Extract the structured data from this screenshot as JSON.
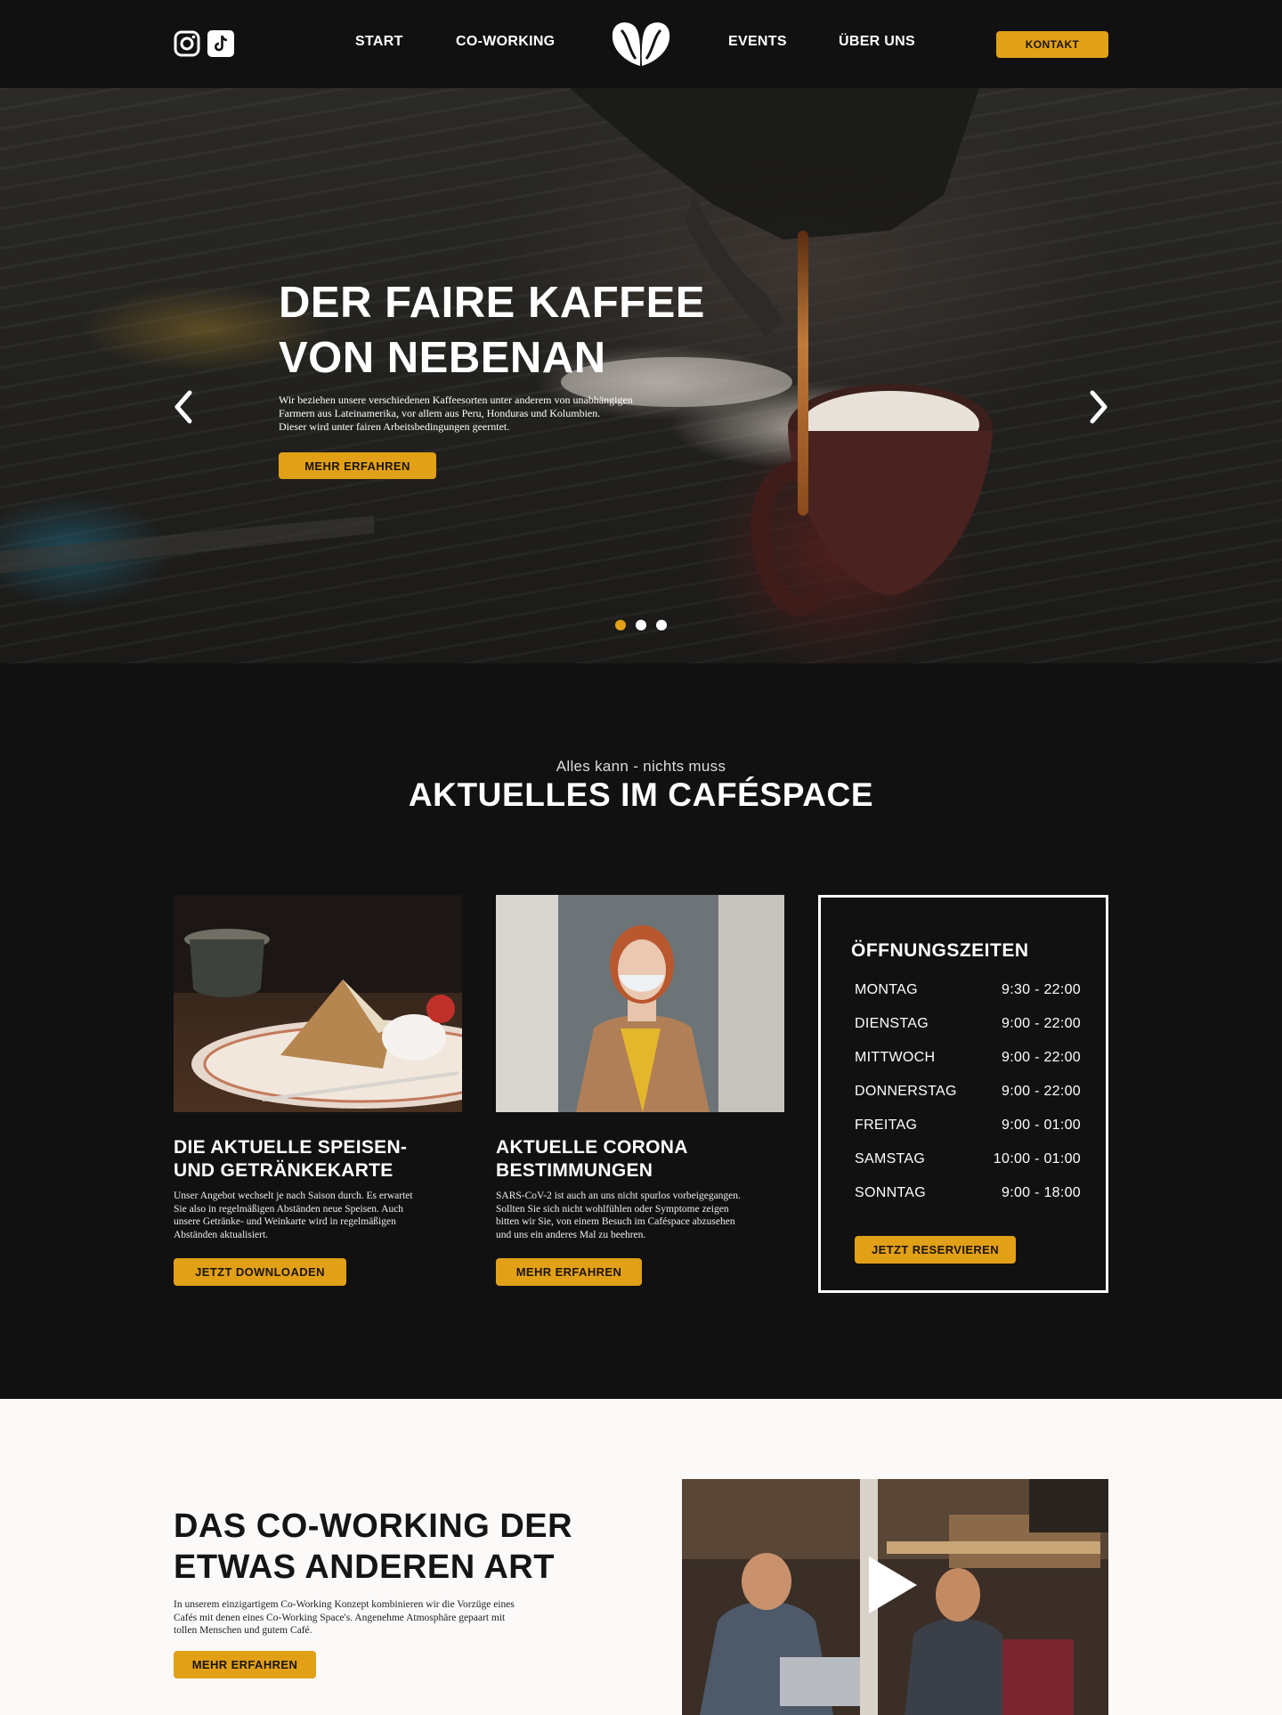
{
  "nav": {
    "links": [
      "START",
      "CO-WORKING",
      "EVENTS",
      "ÜBER UNS"
    ],
    "contact_label": "KONTAKT",
    "social_icons": [
      "instagram-icon",
      "tiktok-icon"
    ],
    "logo_icon": "coffee-bean-heart-logo"
  },
  "hero": {
    "title_line1": "DER FAIRE KAFFEE",
    "title_line2": "VON NEBENAN",
    "text_line1": "Wir beziehen unsere verschiedenen Kaffeesorten unter anderem von unabhängigen",
    "text_line2": "Farmern aus Lateinamerika, vor allem aus Peru, Honduras und Kolumbien.",
    "text_line3": "Dieser wird unter fairen Arbeitsbedingungen geerntet.",
    "button": "MEHR ERFAHREN",
    "slide_count": 3,
    "active_slide": 1
  },
  "aktuelles": {
    "subtitle": "Alles kann - nichts muss",
    "title": "AKTUELLES IM CAFÉSPACE",
    "cards": [
      {
        "title_line1": "DIE AKTUELLE SPEISEN-",
        "title_line2": "UND GETRÄNKEKARTE",
        "text_lines": [
          "Unser Angebot wechselt je nach Saison durch. Es erwartet",
          "Sie also in regelmäßigen Abständen neue Speisen. Auch",
          "unsere Getränke- und Weinkarte wird in regelmäßigen",
          "Abständen aktualisiert."
        ],
        "button": "JETZT DOWNLOADEN"
      },
      {
        "title_line1": "AKTUELLE CORONA",
        "title_line2": "BESTIMMUNGEN",
        "text_lines": [
          "SARS-CoV-2 ist auch an uns nicht spurlos vorbeigegangen.",
          "Sollten Sie sich nicht wohlfühlen oder Symptome zeigen",
          "bitten wir Sie, von einem Besuch im Caféspace abzusehen",
          "und uns ein anderes Mal zu beehren."
        ],
        "button": "MEHR ERFAHREN"
      }
    ],
    "hours": {
      "title": "ÖFFNUNGSZEITEN",
      "rows": [
        {
          "day": "MONTAG",
          "time": "9:30 -  22:00"
        },
        {
          "day": "DIENSTAG",
          "time": "9:00 -  22:00"
        },
        {
          "day": "MITTWOCH",
          "time": "9:00 -  22:00"
        },
        {
          "day": "DONNERSTAG",
          "time": "9:00 -  22:00"
        },
        {
          "day": "FREITAG",
          "time": "9:00 -  01:00"
        },
        {
          "day": "SAMSTAG",
          "time": "10:00 -  01:00"
        },
        {
          "day": "SONNTAG",
          "time": "9:00 -  18:00"
        }
      ],
      "button": "JETZT RESERVIEREN"
    }
  },
  "coworking": {
    "title_line1": "DAS CO-WORKING DER",
    "title_line2": "ETWAS ANDEREN ART",
    "text_lines": [
      "In unserem einzigartigem Co-Working Konzept kombinieren wir die Vorzüge eines",
      "Cafés mit denen eines Co-Working Space's. Angenehme Atmosphäre gepaart mit",
      "tollen Menschen und gutem Café."
    ],
    "button": "MEHR ERFAHREN",
    "video_icon": "play-icon"
  },
  "colors": {
    "accent": "#e2a017",
    "dark_bg": "#121112",
    "light_bg": "#fcf9f9"
  }
}
